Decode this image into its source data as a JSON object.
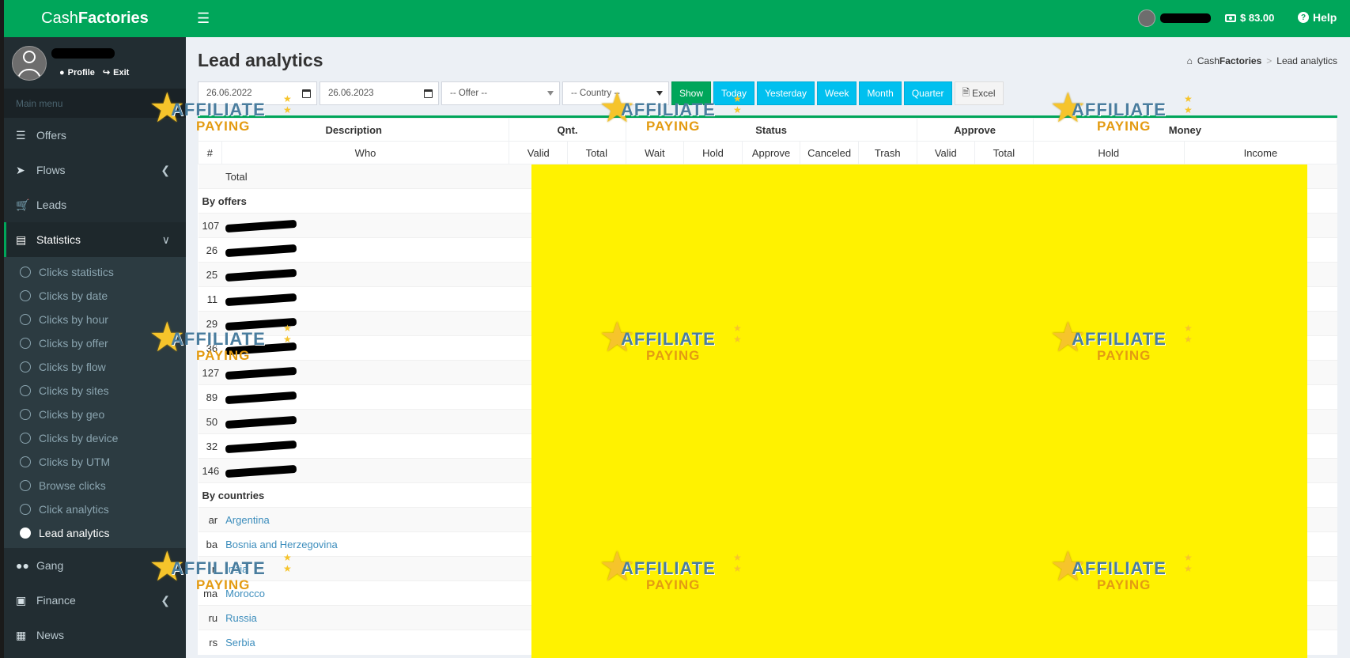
{
  "app": {
    "logo_light": "Cash",
    "logo_bold": "Factories",
    "profile_label": "Profile",
    "exit_label": "Exit",
    "balance": "$ 83.00",
    "help_label": "Help"
  },
  "sidebar": {
    "menu_header": "Main menu",
    "items": [
      {
        "label": "Offers",
        "icon": "list-icon"
      },
      {
        "label": "Flows",
        "icon": "send-icon"
      },
      {
        "label": "Leads",
        "icon": "cart-icon"
      },
      {
        "label": "Statistics",
        "icon": "chart-icon"
      }
    ],
    "stat_sub": [
      "Clicks statistics",
      "Clicks by date",
      "Clicks by hour",
      "Clicks by offer",
      "Clicks by flow",
      "Clicks by sites",
      "Clicks by geo",
      "Clicks by device",
      "Clicks by UTM",
      "Browse clicks",
      "Click analytics",
      "Lead analytics"
    ],
    "items_bottom": [
      {
        "label": "Gang",
        "icon": "users-icon"
      },
      {
        "label": "Finance",
        "icon": "money-icon"
      },
      {
        "label": "News",
        "icon": "news-icon"
      }
    ]
  },
  "page": {
    "title": "Lead analytics",
    "breadcrumb_home_light": "Cash",
    "breadcrumb_home_bold": "Factories",
    "breadcrumb_current": "Lead analytics"
  },
  "filters": {
    "date_from": "26.06.2022",
    "date_to": "26.06.2023",
    "offer_placeholder": "-- Offer --",
    "country_placeholder": "-- Country --",
    "show": "Show",
    "today": "Today",
    "yesterday": "Yesterday",
    "week": "Week",
    "month": "Month",
    "quarter": "Quarter",
    "excel": "Excel"
  },
  "table": {
    "group_headers": [
      "Description",
      "Qnt.",
      "Status",
      "Approve",
      "Money"
    ],
    "col_headers": [
      "#",
      "Who",
      "Valid",
      "Total",
      "Wait",
      "Hold",
      "Approve",
      "Canceled",
      "Trash",
      "Valid",
      "Total",
      "Hold",
      "Income"
    ],
    "total_label": "Total",
    "by_offers_label": "By offers",
    "offer_ids": [
      "107",
      "26",
      "25",
      "11",
      "29",
      "36",
      "127",
      "89",
      "50",
      "32",
      "146"
    ],
    "by_countries_label": "By countries",
    "countries": [
      {
        "code": "ar",
        "name": "Argentina"
      },
      {
        "code": "ba",
        "name": "Bosnia and Herzegovina"
      },
      {
        "code": "in",
        "name": "India"
      },
      {
        "code": "ma",
        "name": "Morocco"
      },
      {
        "code": "ru",
        "name": "Russia"
      },
      {
        "code": "rs",
        "name": "Serbia"
      }
    ]
  },
  "watermark": {
    "line1": "AFFILIATE",
    "line2": "PAYING"
  }
}
